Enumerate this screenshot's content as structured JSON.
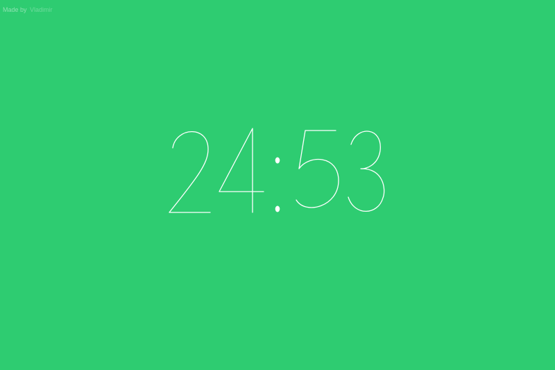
{
  "credit": {
    "prefix": "Made by",
    "author": "Vladimir"
  },
  "timer": {
    "minutes": "24",
    "seconds": "53",
    "separator": ":"
  },
  "colors": {
    "background": "#2ecc71",
    "digits": "#ffffff"
  }
}
